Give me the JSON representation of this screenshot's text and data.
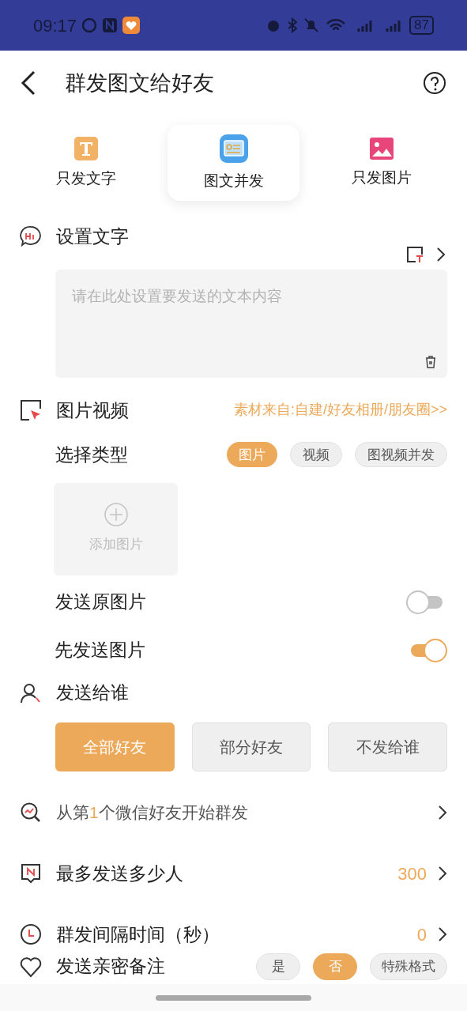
{
  "status_bar": {
    "time": "09:17",
    "battery": "87"
  },
  "header": {
    "title": "群发图文给好友"
  },
  "modes": [
    {
      "label": "只发文字",
      "kind": "text",
      "selected": false
    },
    {
      "label": "图文并发",
      "kind": "both",
      "selected": true
    },
    {
      "label": "只发图片",
      "kind": "image",
      "selected": false
    }
  ],
  "text_section": {
    "title": "设置文字",
    "placeholder": "请在此处设置要发送的文本内容"
  },
  "media_section": {
    "title": "图片视频",
    "source_link": "素材来自:自建/好友相册/朋友圈>>",
    "type_label": "选择类型",
    "types": [
      {
        "label": "图片",
        "selected": true
      },
      {
        "label": "视频",
        "selected": false
      },
      {
        "label": "图视频并发",
        "selected": false
      }
    ],
    "add_label": "添加图片",
    "toggles": [
      {
        "label": "发送原图片",
        "on": false
      },
      {
        "label": "先发送图片",
        "on": true
      }
    ]
  },
  "recipients": {
    "title": "发送给谁",
    "options": [
      {
        "label": "全部好友",
        "selected": true
      },
      {
        "label": "部分好友",
        "selected": false
      },
      {
        "label": "不发给谁",
        "selected": false
      }
    ]
  },
  "settings": [
    {
      "kind": "start",
      "prefix": "从第",
      "number": "1",
      "suffix": "个微信好友开始群发"
    },
    {
      "kind": "max",
      "label": "最多发送多少人",
      "value": "300"
    },
    {
      "kind": "interval",
      "label": "群发间隔时间（秒）",
      "value": "0"
    }
  ],
  "remark": {
    "label": "发送亲密备注",
    "options": [
      {
        "label": "是",
        "selected": false
      },
      {
        "label": "否",
        "selected": true
      },
      {
        "label": "特殊格式",
        "selected": false
      }
    ]
  }
}
